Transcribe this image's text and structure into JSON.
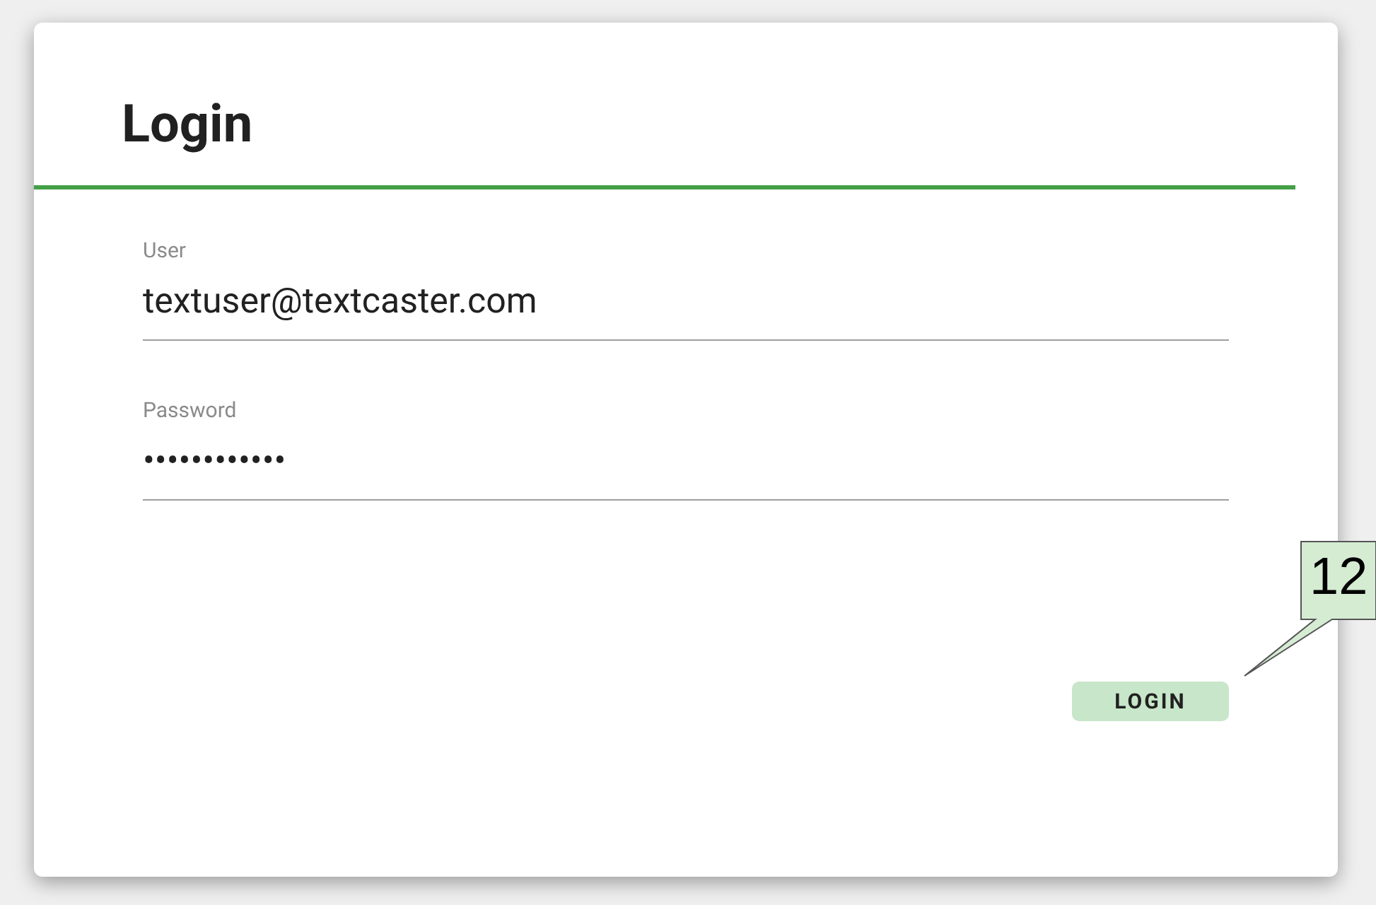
{
  "card": {
    "title": "Login"
  },
  "fields": [
    {
      "label": "User",
      "value": "textuser@textcaster.com"
    },
    {
      "label": "Password",
      "value": "••••••••••••"
    }
  ],
  "button": {
    "label": "LOGIN"
  },
  "callout": {
    "text": "12"
  }
}
